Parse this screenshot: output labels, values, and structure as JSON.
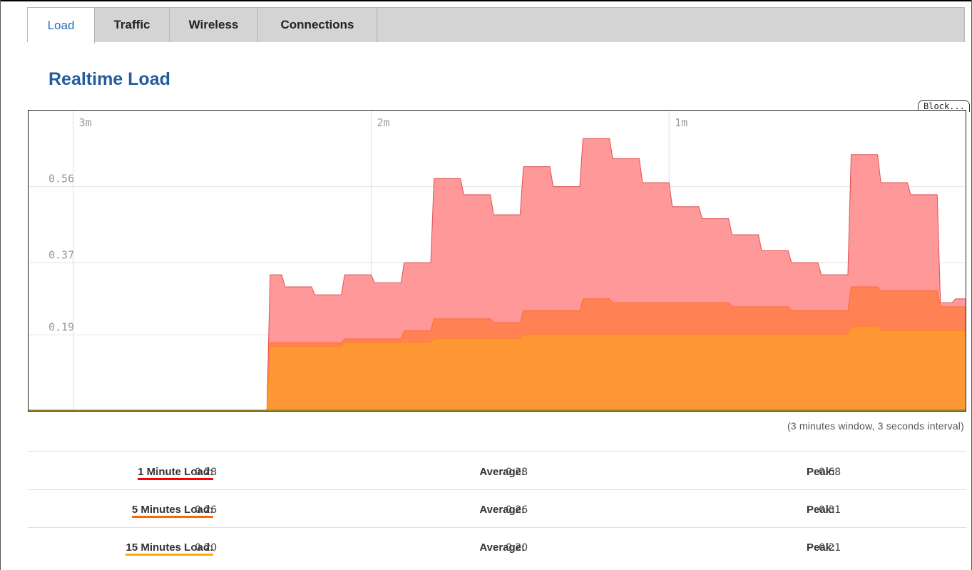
{
  "tabs": [
    {
      "label": "Load",
      "active": true
    },
    {
      "label": "Traffic",
      "active": false
    },
    {
      "label": "Wireless",
      "active": false
    },
    {
      "label": "Connections",
      "active": false
    }
  ],
  "page_title": "Realtime Load",
  "block_button_label": "Block...",
  "window_note": "(3 minutes window, 3 seconds interval)",
  "colors": {
    "accent": "#2a6fb8",
    "load_1min": "#ff9999",
    "load_5min": "#ff7f50",
    "load_15min": "#ff9933",
    "underline_1min": "#ff0000",
    "underline_5min": "#ff6600",
    "underline_15min": "#ffaa00"
  },
  "stats": [
    {
      "label": "1 Minute Load:",
      "value": "0.28",
      "avg_label": "Average:",
      "avg": "0.28",
      "peak_label": "Peak:",
      "peak": "0.68"
    },
    {
      "label": "5 Minutes Load:",
      "value": "0.26",
      "avg_label": "Average:",
      "avg": "0.26",
      "peak_label": "Peak:",
      "peak": "0.31"
    },
    {
      "label": "15 Minutes Load:",
      "value": "0.20",
      "avg_label": "Average:",
      "avg": "0.20",
      "peak_label": "Peak:",
      "peak": "0.21"
    }
  ],
  "chart_data": {
    "type": "area",
    "title": "",
    "x_tick_labels": [
      "3m",
      "2m",
      "1m"
    ],
    "y_tick_labels": [
      "0.56",
      "0.37",
      "0.19"
    ],
    "y_ticks": [
      0.56,
      0.37,
      0.19
    ],
    "ylim": [
      0,
      0.75
    ],
    "x_unit": "seconds ago",
    "x": [
      189,
      186,
      183,
      180,
      177,
      174,
      171,
      168,
      165,
      162,
      159,
      156,
      153,
      150,
      147,
      144,
      141,
      138,
      135,
      132,
      129,
      126,
      123,
      120,
      117,
      114,
      111,
      108,
      105,
      102,
      99,
      96,
      93,
      90,
      87,
      84,
      81,
      78,
      75,
      72,
      69,
      66,
      63,
      60,
      57,
      54,
      51,
      48,
      45,
      42,
      39,
      36,
      33,
      30,
      27,
      24,
      21,
      18,
      15,
      12,
      9,
      6,
      3,
      0
    ],
    "grid": true,
    "series": [
      {
        "name": "1 Minute Load",
        "values": [
          0.0,
          0.0,
          0.0,
          0.0,
          0.0,
          0.0,
          0.0,
          0.0,
          0.0,
          0.0,
          0.0,
          0.0,
          0.0,
          0.0,
          0.0,
          0.0,
          0.0,
          0.34,
          0.31,
          0.31,
          0.29,
          0.29,
          0.34,
          0.34,
          0.32,
          0.32,
          0.37,
          0.37,
          0.58,
          0.58,
          0.54,
          0.54,
          0.49,
          0.49,
          0.61,
          0.61,
          0.56,
          0.56,
          0.68,
          0.68,
          0.63,
          0.63,
          0.57,
          0.57,
          0.51,
          0.51,
          0.48,
          0.48,
          0.44,
          0.44,
          0.4,
          0.4,
          0.37,
          0.37,
          0.34,
          0.34,
          0.64,
          0.64,
          0.57,
          0.57,
          0.54,
          0.54,
          0.27,
          0.28
        ]
      },
      {
        "name": "5 Minutes Load",
        "values": [
          0.0,
          0.0,
          0.0,
          0.0,
          0.0,
          0.0,
          0.0,
          0.0,
          0.0,
          0.0,
          0.0,
          0.0,
          0.0,
          0.0,
          0.0,
          0.0,
          0.0,
          0.17,
          0.17,
          0.17,
          0.17,
          0.17,
          0.18,
          0.18,
          0.18,
          0.18,
          0.2,
          0.2,
          0.23,
          0.23,
          0.23,
          0.23,
          0.22,
          0.22,
          0.25,
          0.25,
          0.25,
          0.25,
          0.28,
          0.28,
          0.27,
          0.27,
          0.27,
          0.27,
          0.27,
          0.27,
          0.27,
          0.27,
          0.26,
          0.26,
          0.26,
          0.26,
          0.25,
          0.25,
          0.25,
          0.25,
          0.31,
          0.31,
          0.3,
          0.3,
          0.3,
          0.3,
          0.26,
          0.26
        ]
      },
      {
        "name": "15 Minutes Load",
        "values": [
          0.0,
          0.0,
          0.0,
          0.0,
          0.0,
          0.0,
          0.0,
          0.0,
          0.0,
          0.0,
          0.0,
          0.0,
          0.0,
          0.0,
          0.0,
          0.0,
          0.0,
          0.16,
          0.16,
          0.16,
          0.16,
          0.16,
          0.17,
          0.17,
          0.17,
          0.17,
          0.17,
          0.17,
          0.18,
          0.18,
          0.18,
          0.18,
          0.18,
          0.18,
          0.19,
          0.19,
          0.19,
          0.19,
          0.19,
          0.19,
          0.19,
          0.19,
          0.19,
          0.19,
          0.19,
          0.19,
          0.19,
          0.19,
          0.19,
          0.19,
          0.19,
          0.19,
          0.19,
          0.19,
          0.19,
          0.19,
          0.21,
          0.21,
          0.2,
          0.2,
          0.2,
          0.2,
          0.2,
          0.2
        ]
      }
    ]
  }
}
